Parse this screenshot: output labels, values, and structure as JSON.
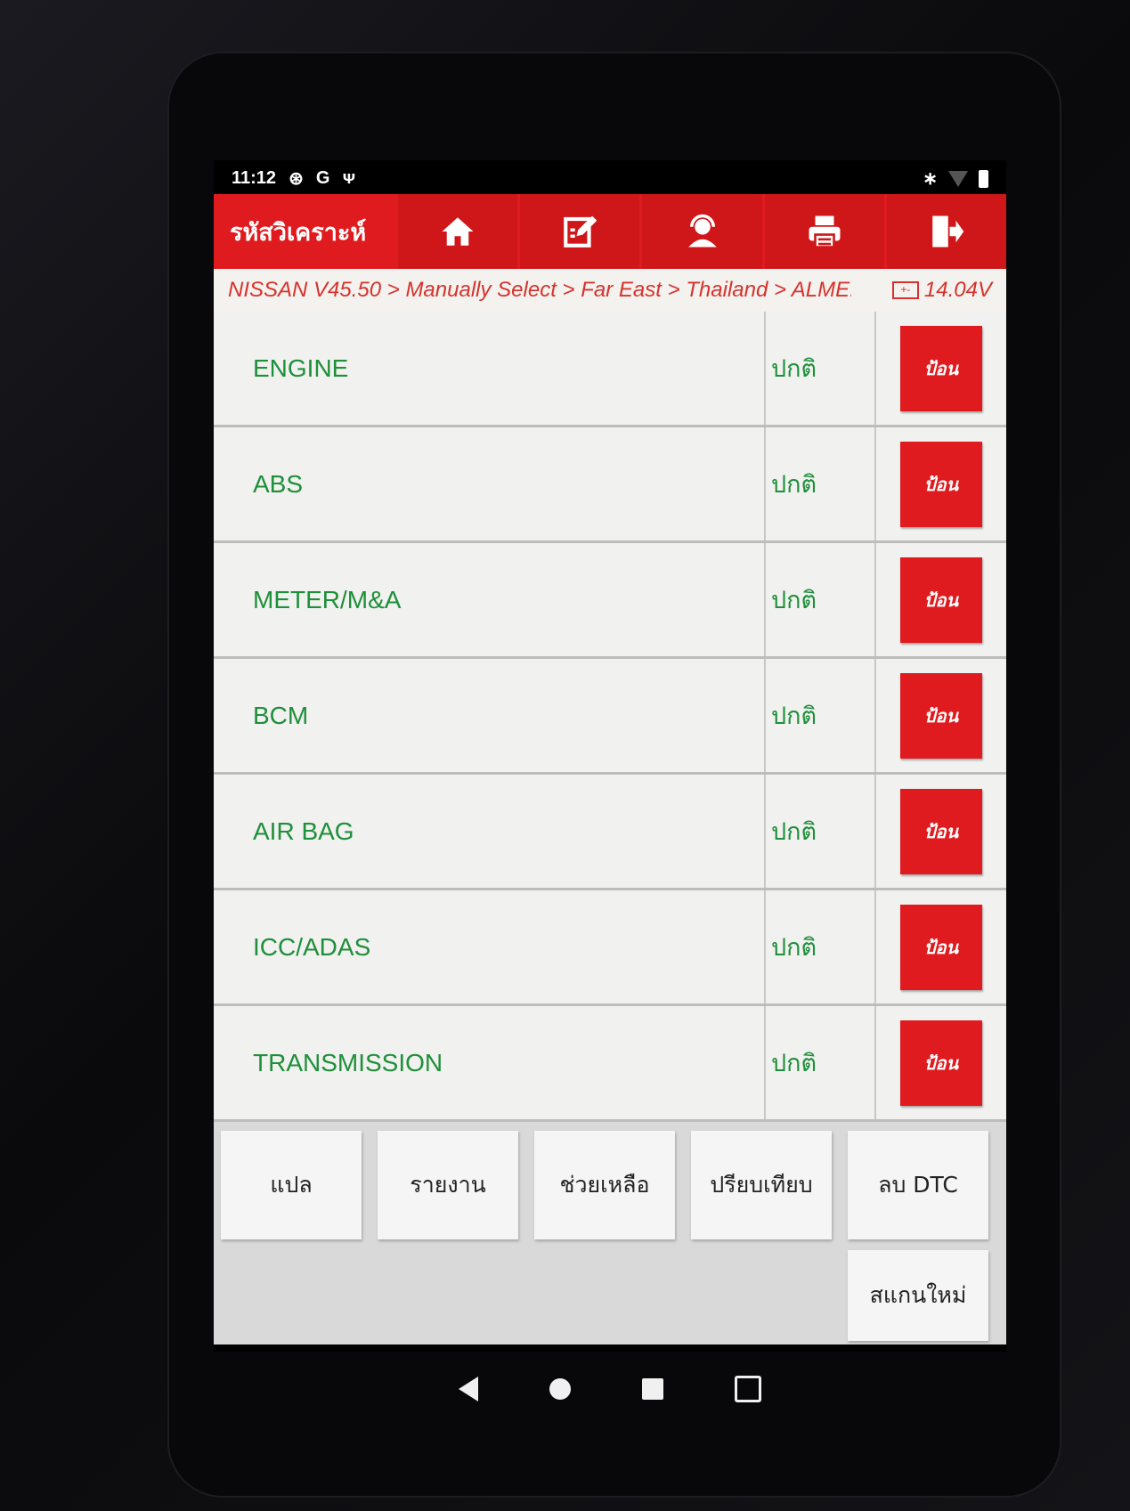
{
  "status_bar": {
    "time": "11:12",
    "icons_left": [
      "sync-icon",
      "google-icon",
      "usb-icon"
    ],
    "icons_right": [
      "bluetooth-icon",
      "wifi-icon",
      "battery-icon"
    ]
  },
  "toolbar": {
    "title": "รหัสวิเคราะห์",
    "buttons": [
      {
        "name": "home-button",
        "icon": "home-icon"
      },
      {
        "name": "edit-button",
        "icon": "edit-icon"
      },
      {
        "name": "support-button",
        "icon": "support-agent-icon"
      },
      {
        "name": "print-button",
        "icon": "printer-icon"
      },
      {
        "name": "exit-button",
        "icon": "exit-icon"
      }
    ]
  },
  "breadcrumb": {
    "path": "NISSAN V45.50 > Manually Select > Far East > Thailand > ALME...",
    "voltage": "14.04V"
  },
  "systems": [
    {
      "name": "ENGINE",
      "status": "ปกติ",
      "enter": "ป้อน"
    },
    {
      "name": "ABS",
      "status": "ปกติ",
      "enter": "ป้อน"
    },
    {
      "name": "METER/M&A",
      "status": "ปกติ",
      "enter": "ป้อน"
    },
    {
      "name": "BCM",
      "status": "ปกติ",
      "enter": "ป้อน"
    },
    {
      "name": "AIR BAG",
      "status": "ปกติ",
      "enter": "ป้อน"
    },
    {
      "name": "ICC/ADAS",
      "status": "ปกติ",
      "enter": "ป้อน"
    },
    {
      "name": "TRANSMISSION",
      "status": "ปกติ",
      "enter": "ป้อน"
    }
  ],
  "actions": {
    "translate": "แปล",
    "report": "รายงาน",
    "help": "ช่วยเหลือ",
    "compare": "ปรียบเทียบ",
    "clear_dtc": "ลบ DTC",
    "rescan": "สแกนใหม่"
  },
  "colors": {
    "accent_red": "#e01b1f",
    "system_green": "#1e8f3a",
    "breadcrumb_red": "#d6322d"
  }
}
